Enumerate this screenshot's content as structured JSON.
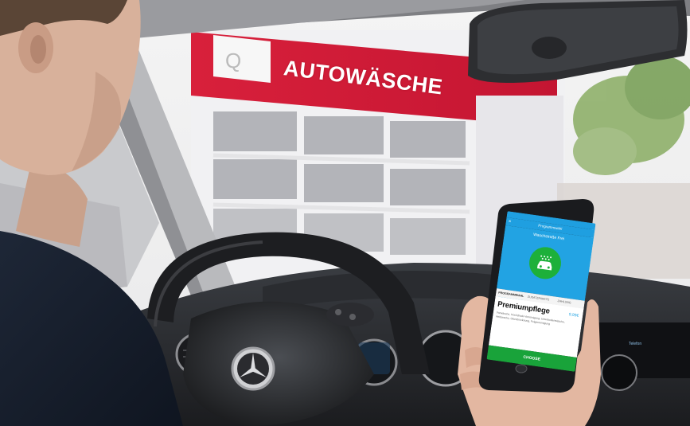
{
  "scene": {
    "description_elements": [
      "car-interior",
      "steering-wheel",
      "smartphone",
      "car-wash-building",
      "rearview-mirror"
    ]
  },
  "building_sign": {
    "text": "AUTOWÄSCHE"
  },
  "phone": {
    "status_bar": "",
    "title": "Programmwahl",
    "hero_title": "Waschstraße Frei",
    "tabs": [
      "PROGRAMMWAHL",
      "ZUSATZPAKETE",
      "ZAHLUNG"
    ],
    "product_name": "Premiumpflege",
    "product_price": "9,99€",
    "product_description": "Vorwäsche, Hochdruck-Vorreinigung, Unterbodenwäsche, Heißwachs, Glanztrocknung, Felgenreinigung",
    "button_label": "CHOOSE"
  },
  "colors": {
    "sign_red": "#c8102e",
    "phone_blue": "#22a3e3",
    "phone_green": "#19a33a"
  }
}
